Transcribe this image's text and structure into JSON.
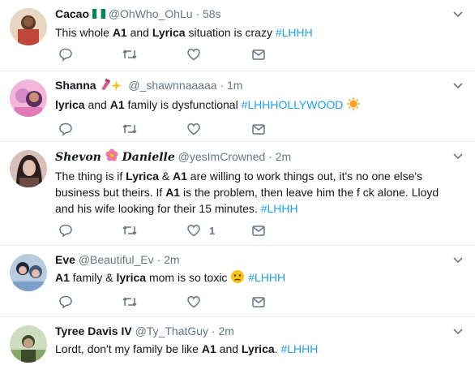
{
  "tweets": [
    {
      "name": "Cacao",
      "handle": "@OhWho_OhLu",
      "time": "58s",
      "text_parts": [
        "This whole ",
        "A1",
        " and ",
        "Lyrica",
        " situation is crazy "
      ],
      "hashtag": "#LHHH",
      "avatar_colors": [
        "#5a3a2a",
        "#c0463a",
        "#2b1a12"
      ],
      "name_icon": "nigeria-flag-icon",
      "like_count": ""
    },
    {
      "name": "Shanna",
      "handle": "@_shawnnaaaaa",
      "time": "1m",
      "text_parts": [
        "lyrica",
        " and ",
        "A1",
        " family is dysfunctional "
      ],
      "hashtag": "#LHHHOLLYWOOD",
      "avatar_colors": [
        "#d38ac8",
        "#f2b6d8",
        "#5a2e5e"
      ],
      "name_icon": "nail-polish-sparkles-icon",
      "like_count": ""
    },
    {
      "name": "Shevon",
      "name2": "Danielle",
      "handle": "@yesImCrowned",
      "time": "2m",
      "text": "The thing is if ",
      "text_parts": [
        "Lyrica",
        " & ",
        "A1",
        " are willing to work things out, it's no one else's business but theirs. If ",
        "A1",
        " is the problem, then leave him the f  ck alone. Lloyd and his wife looking for their 15 minutes. "
      ],
      "hashtag": "#LHHH",
      "avatar_colors": [
        "#6a4a42",
        "#e4c2b4",
        "#2d1f1f"
      ],
      "name_icon": "hibiscus-icon",
      "like_count": "1"
    },
    {
      "name": "Eve",
      "handle": "@Beautiful_Ev",
      "time": "2m",
      "text_parts": [
        "A1",
        " family & ",
        "lyrica",
        " mom is so toxic "
      ],
      "hashtag": "#LHHH",
      "avatar_colors": [
        "#3d5a7a",
        "#e8b8b0",
        "#1e2a3a"
      ],
      "name_icon": "",
      "like_count": ""
    },
    {
      "name": "Tyree Davis IV",
      "handle": "@Ty_ThatGuy",
      "time": "2m",
      "text_parts": [
        "Lordt, don't my family be like ",
        "A1",
        " and ",
        "Lyrica",
        ". "
      ],
      "hashtag": "#LHHH",
      "avatar_colors": [
        "#88a86a",
        "#c0a080",
        "#3a4a2a"
      ],
      "name_icon": "",
      "like_count": ""
    }
  ],
  "ui": {
    "dot": "·"
  }
}
